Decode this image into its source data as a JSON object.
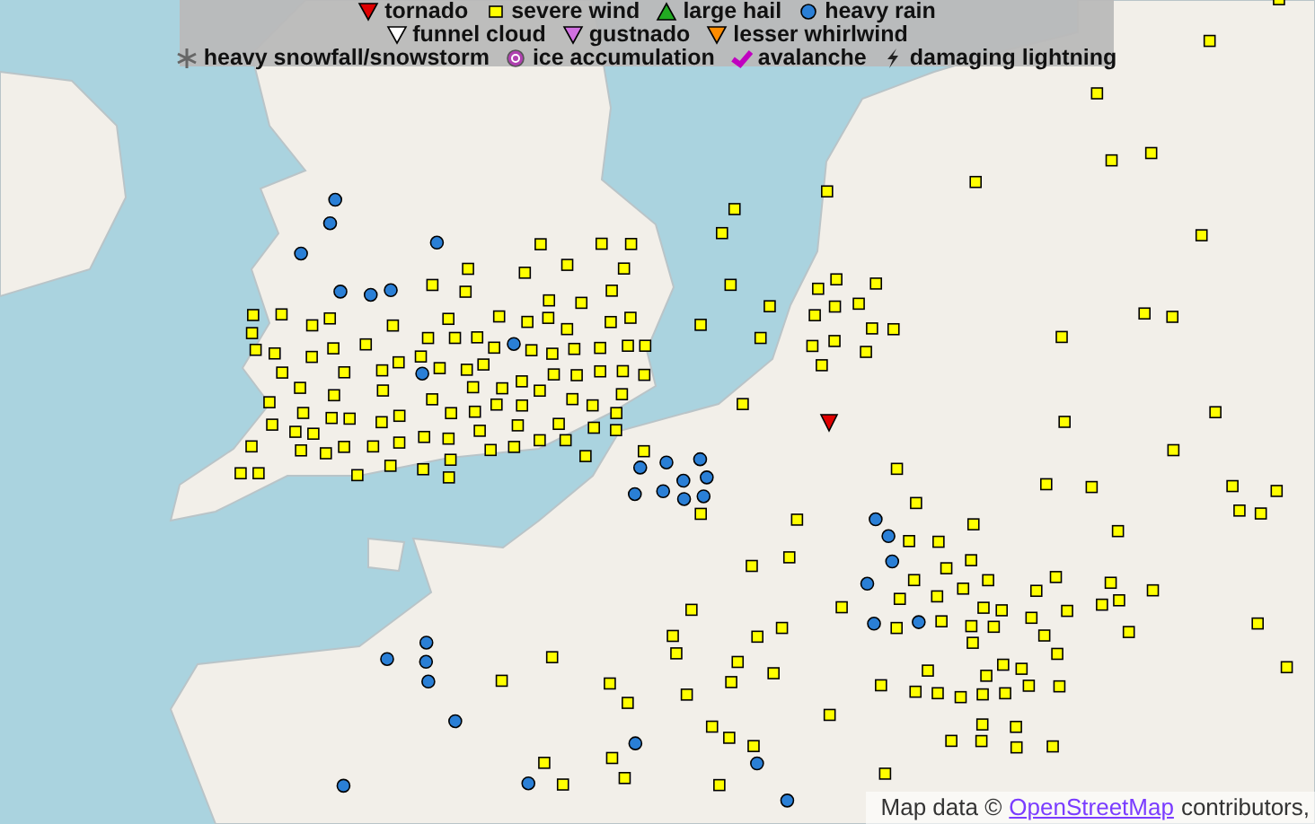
{
  "legend": {
    "rows": [
      [
        {
          "kind": "tornado",
          "label": "tornado"
        },
        {
          "kind": "severe_wind",
          "label": "severe wind"
        },
        {
          "kind": "large_hail",
          "label": "large hail"
        },
        {
          "kind": "heavy_rain",
          "label": "heavy rain"
        }
      ],
      [
        {
          "kind": "funnel_cloud",
          "label": "funnel cloud"
        },
        {
          "kind": "gustnado",
          "label": "gustnado"
        },
        {
          "kind": "lesser_whirlwind",
          "label": "lesser whirlwind"
        }
      ],
      [
        {
          "kind": "snowfall",
          "label": "heavy snowfall/snowstorm"
        },
        {
          "kind": "ice",
          "label": "ice accumulation"
        },
        {
          "kind": "avalanche",
          "label": "avalanche"
        },
        {
          "kind": "lightning",
          "label": "damaging lightning"
        }
      ]
    ]
  },
  "attribution": {
    "prefix": "Map data ©",
    "link": "OpenStreetMap",
    "suffix": "contributors,"
  }
}
